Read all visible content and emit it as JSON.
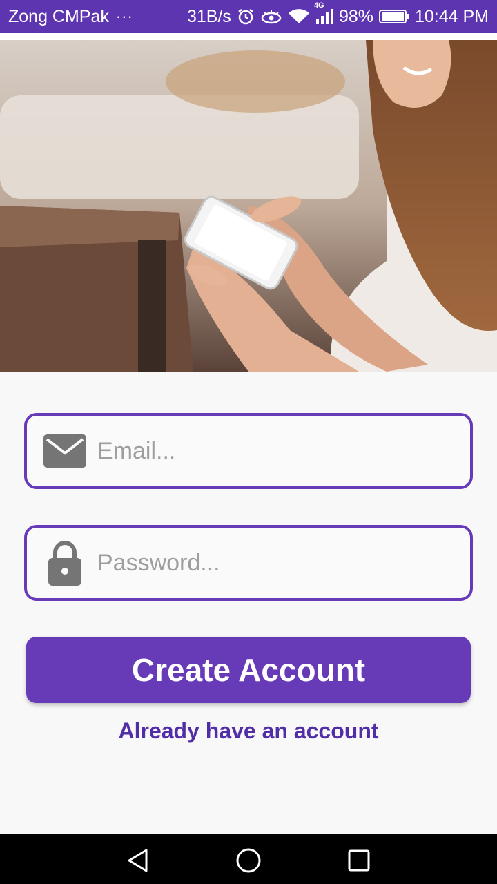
{
  "status_bar": {
    "carrier": "Zong CMPak",
    "more": "···",
    "net_speed": "31B/s",
    "network_type": "4G",
    "battery_percent": "98%",
    "time": "10:44 PM",
    "icons": [
      "alarm-icon",
      "eye-icon",
      "wifi-icon",
      "signal-icon",
      "battery-icon"
    ],
    "background_color": "#5e35b1"
  },
  "hero": {
    "icon": "woman-using-phone-photo"
  },
  "form": {
    "email": {
      "placeholder": "Email...",
      "value": "",
      "icon": "envelope-icon"
    },
    "password": {
      "placeholder": "Password...",
      "value": "",
      "icon": "lock-icon"
    },
    "create_label": "Create Account",
    "login_link": "Already have an account"
  },
  "colors": {
    "accent": "#673ab7",
    "link": "#512da8",
    "icon_gray": "#757575"
  },
  "nav_bar": {
    "icons": [
      "back-icon",
      "home-icon",
      "recents-icon"
    ]
  }
}
